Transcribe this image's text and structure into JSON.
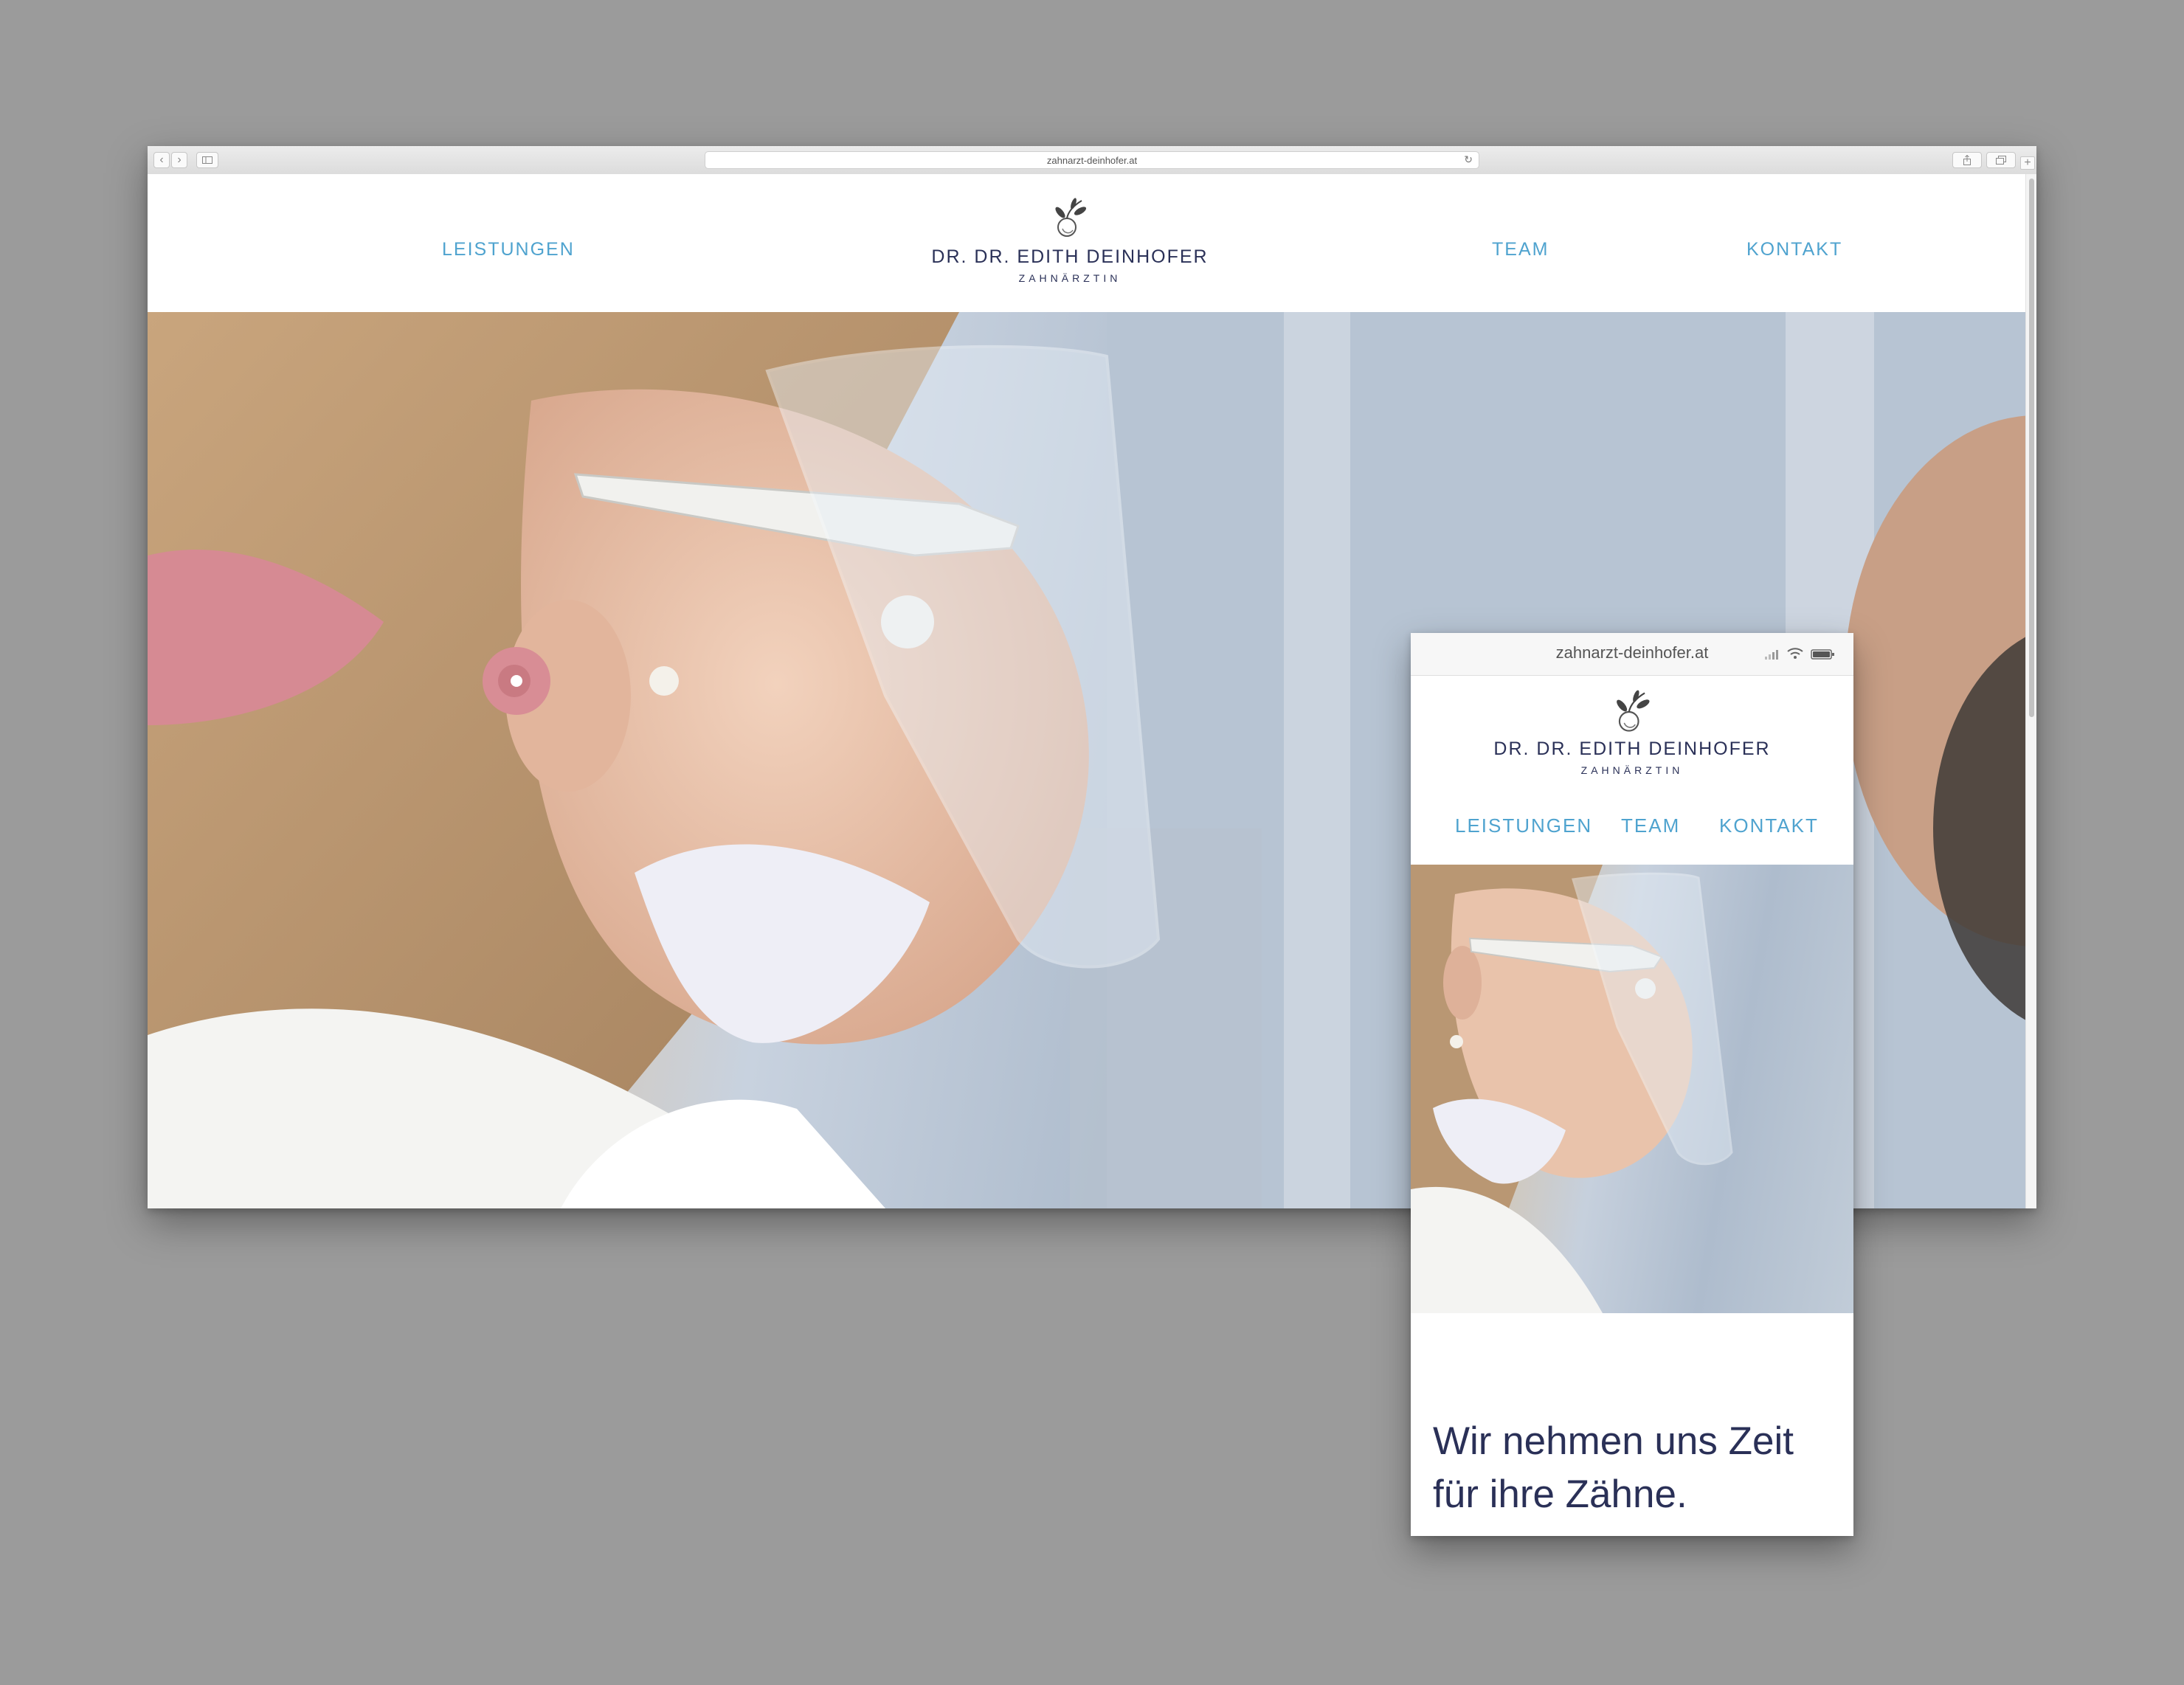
{
  "desktop": {
    "url": "zahnarzt-deinhofer.at",
    "nav": {
      "leistungen": "LEISTUNGEN",
      "team": "TEAM",
      "kontakt": "KONTAKT"
    },
    "logo": {
      "name": "DR. DR. EDITH DEINHOFER",
      "subtitle": "ZAHNÄRZTIN"
    }
  },
  "mobile": {
    "url": "zahnarzt-deinhofer.at",
    "logo": {
      "name": "DR. DR. EDITH DEINHOFER",
      "subtitle": "ZAHNÄRZTIN"
    },
    "nav": {
      "leistungen": "LEISTUNGEN",
      "team": "TEAM",
      "kontakt": "KONTAKT"
    },
    "tagline_line1": "Wir nehmen uns Zeit",
    "tagline_line2": "für ihre Zähne."
  },
  "colors": {
    "accent": "#4fa3cf",
    "brand_navy": "#2a3057",
    "backdrop": "#9b9b9b"
  },
  "icons": [
    "back-icon",
    "forward-icon",
    "sidebar-icon",
    "reload-icon",
    "share-icon",
    "tabs-icon",
    "new-tab-icon",
    "signal-icon",
    "wifi-icon",
    "battery-icon",
    "apple-branch-logo-icon"
  ]
}
